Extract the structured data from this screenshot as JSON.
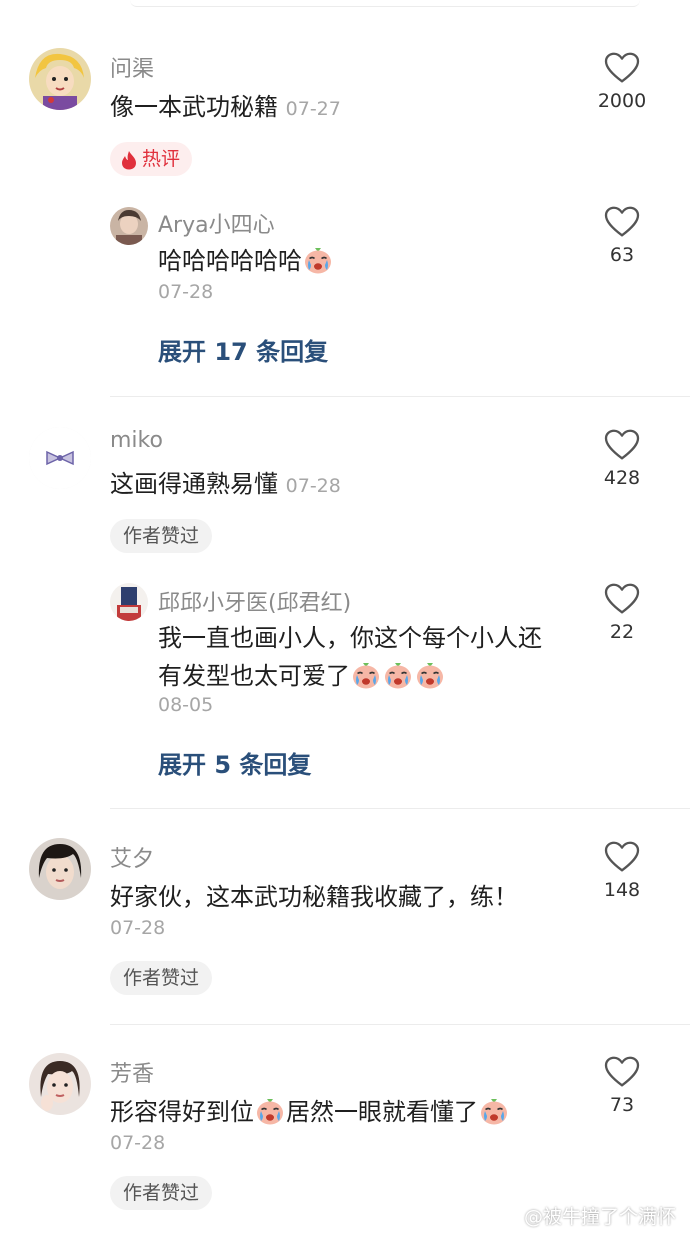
{
  "comments": [
    {
      "user": "问渠",
      "text": "像一本武功秘籍",
      "date": "07-27",
      "likes": "2000",
      "badge": "热评",
      "reply": {
        "user": "Arya小四心",
        "text": "哈哈哈哈哈哈",
        "date": "07-28",
        "likes": "63"
      },
      "expand": "展开 17 条回复"
    },
    {
      "user": "miko",
      "text": "这画得通熟易懂",
      "date": "07-28",
      "likes": "428",
      "badge": "作者赞过",
      "reply": {
        "user": "邱邱小牙医(邱君红)",
        "text_line1": "我一直也画小人，你这个每个小人还",
        "text_line2": "有发型也太可爱了",
        "date": "08-05",
        "likes": "22"
      },
      "expand": "展开 5 条回复"
    },
    {
      "user": "艾夕",
      "text": "好家伙，这本武功秘籍我收藏了，练！",
      "date": "07-28",
      "likes": "148",
      "badge": "作者赞过"
    },
    {
      "user": "芳香",
      "text_part1": "形容得好到位",
      "text_part2": "居然一眼就看懂了",
      "date": "07-28",
      "likes": "73",
      "badge": "作者赞过"
    }
  ],
  "watermark": "@被牛撞了个满怀",
  "icons": {
    "like": "heart-outline-icon",
    "hot": "flame-icon",
    "emoji": "crying-face-emoji"
  },
  "colors": {
    "hot": "#e0303c",
    "expand": "#2a4f7a",
    "muted": "#8a8a8a"
  }
}
